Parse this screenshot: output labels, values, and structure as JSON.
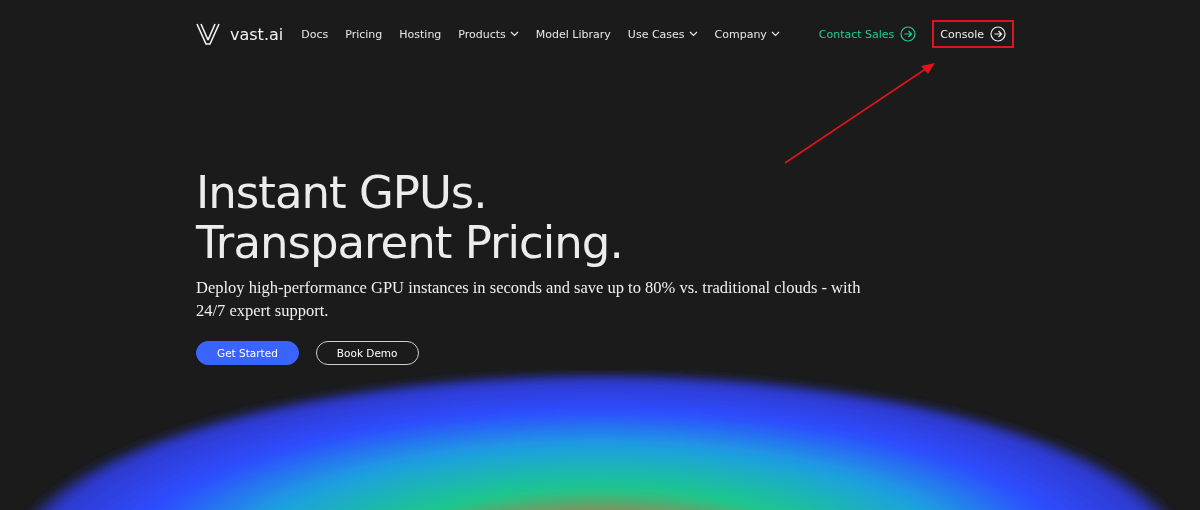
{
  "brand": {
    "name": "vast.ai"
  },
  "nav": [
    {
      "label": "Docs",
      "has_menu": false
    },
    {
      "label": "Pricing",
      "has_menu": false
    },
    {
      "label": "Hosting",
      "has_menu": false
    },
    {
      "label": "Products",
      "has_menu": true
    },
    {
      "label": "Model Library",
      "has_menu": false
    },
    {
      "label": "Use Cases",
      "has_menu": true
    },
    {
      "label": "Company",
      "has_menu": true
    }
  ],
  "actions": [
    {
      "label": "Contact Sales",
      "kind": "accent",
      "highlighted": false
    },
    {
      "label": "Console",
      "kind": "plain",
      "highlighted": true
    }
  ],
  "hero": {
    "headline": [
      "Instant GPUs.",
      "Transparent Pricing."
    ],
    "subtitle": "Deploy high-performance GPU instances in seconds and save up to 80% vs. traditional clouds - with 24/7 expert support.",
    "buttons": [
      {
        "label": "Get Started",
        "kind": "primary"
      },
      {
        "label": "Book Demo",
        "kind": "outline"
      }
    ]
  }
}
